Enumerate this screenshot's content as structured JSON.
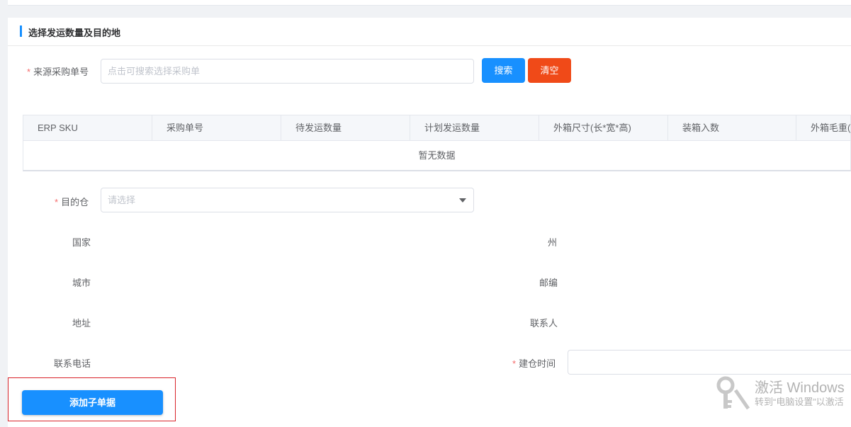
{
  "section": {
    "title": "选择发运数量及目的地"
  },
  "source_po": {
    "label": "来源采购单号",
    "placeholder": "点击可搜索选择采购单",
    "search_label": "搜索",
    "clear_label": "清空"
  },
  "table": {
    "columns": [
      "ERP SKU",
      "采购单号",
      "待发运数量",
      "计划发运数量",
      "外箱尺寸(长*宽*高)",
      "装箱入数",
      "外箱毛重("
    ],
    "empty_text": "暂无数据"
  },
  "destination": {
    "label": "目的仓",
    "placeholder": "请选择"
  },
  "fields": {
    "country": "国家",
    "state": "州",
    "city": "城市",
    "zip": "邮编",
    "address": "地址",
    "contact": "联系人",
    "phone": "联系电话",
    "build_time": "建仓时间"
  },
  "actions": {
    "add_sub_order": "添加子单据"
  },
  "watermark": {
    "line1": "激活 Windows",
    "line2": "转到“电脑设置”以激活"
  },
  "colors": {
    "primary": "#1890ff",
    "danger": "#f04a18",
    "required": "#f56c6c"
  }
}
